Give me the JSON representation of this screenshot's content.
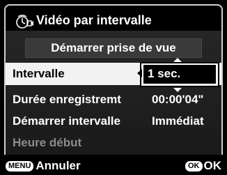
{
  "header": {
    "title": "Vidéo par intervalle",
    "icon": "interval-movie-icon"
  },
  "start_button": {
    "label": "Démarrer prise de vue"
  },
  "menu": {
    "items": [
      {
        "label": "Intervalle",
        "value": "1 sec.",
        "selected": true
      },
      {
        "label": "Durée enregistremt",
        "value": "00:00'04\""
      },
      {
        "label": "Démarrer intervalle",
        "value": "Immédiat"
      },
      {
        "label": "Heure début",
        "value": "",
        "disabled": true
      }
    ]
  },
  "footer": {
    "cancel_badge": "MENU",
    "cancel_label": "Annuler",
    "ok_badge": "OK",
    "ok_label": "OK"
  },
  "colors": {
    "background": "#000000",
    "panel": "#222222",
    "highlight": "#f2f2f2",
    "disabled_text": "#8c8c8c"
  }
}
